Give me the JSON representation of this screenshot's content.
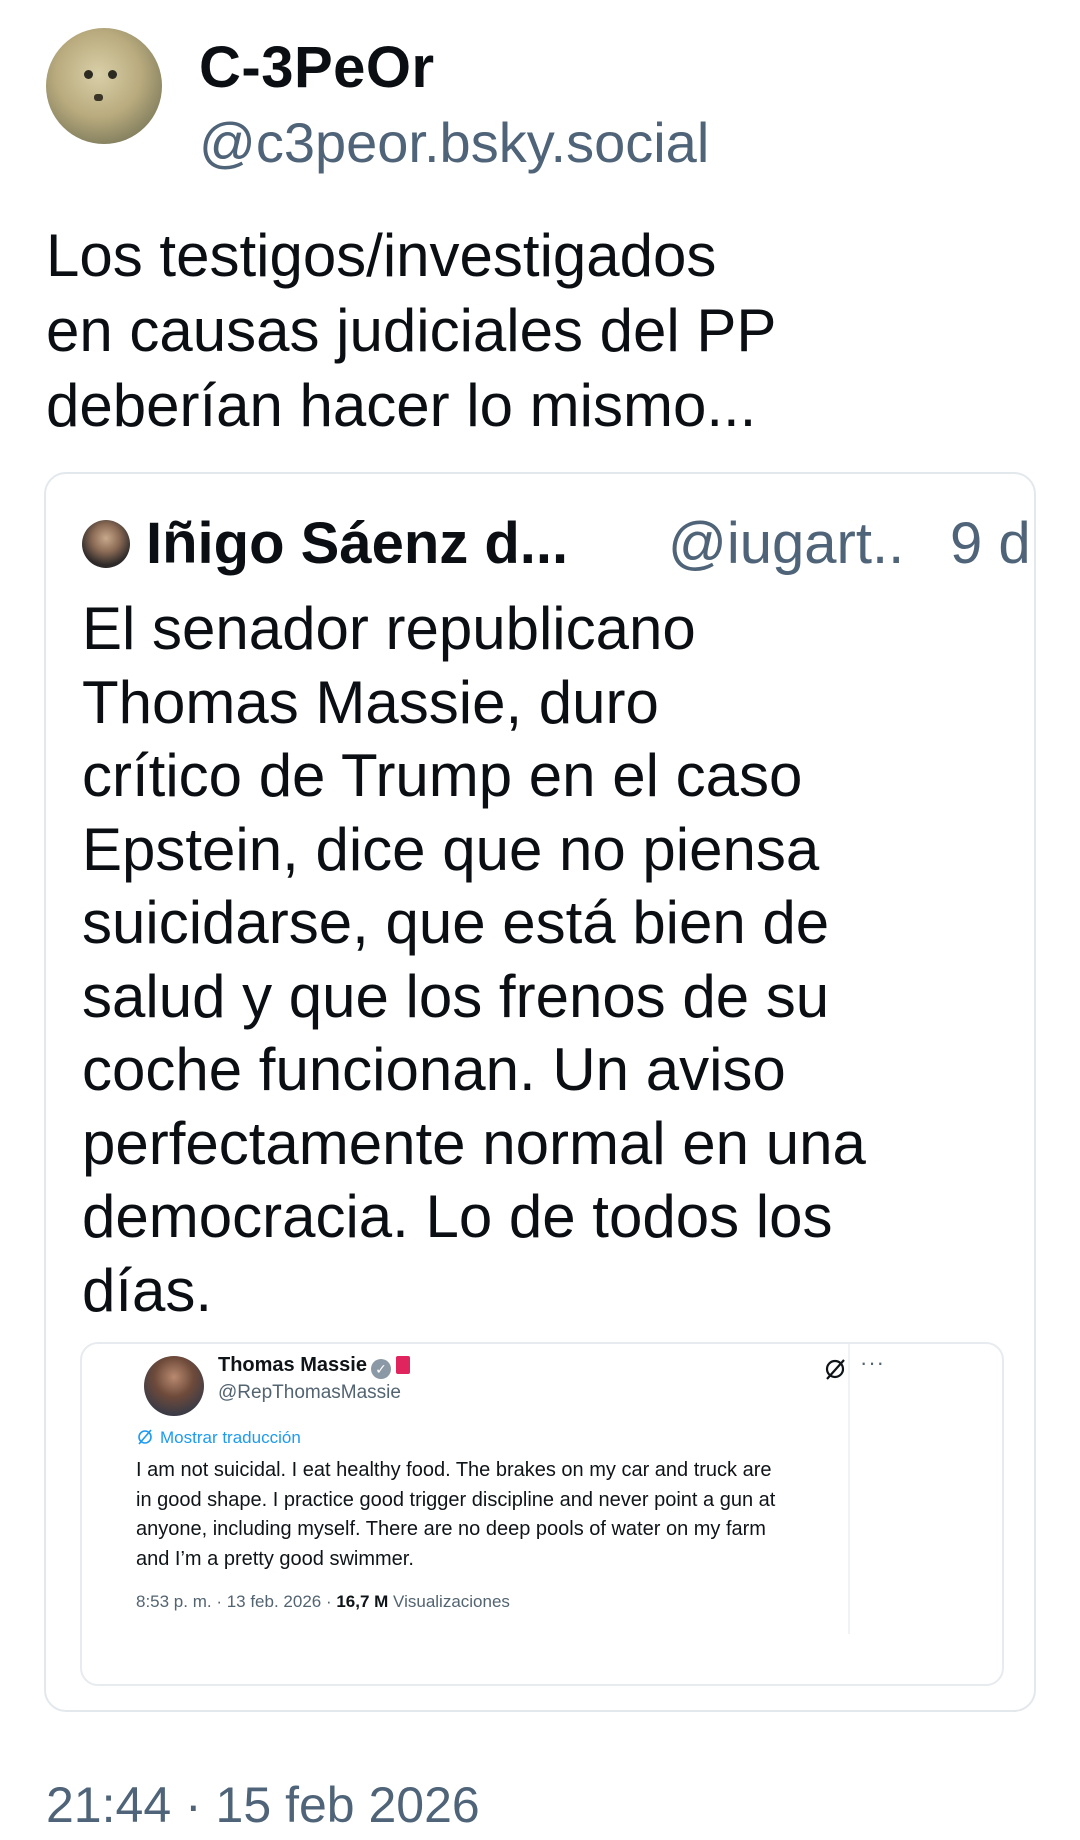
{
  "post": {
    "display_name": "C-3PeOr",
    "handle": "@c3peor.bsky.social",
    "text_lines": [
      "Los testigos/investigados",
      "en causas judiciales del PP",
      "deberían hacer lo mismo..."
    ],
    "timestamp": "21:44 · 15 feb 2026"
  },
  "quote": {
    "display_name": "Iñigo Sáenz d...",
    "handle": "@iugart..",
    "time": "9 d",
    "text_lines": [
      "El senador republicano",
      "Thomas Massie, duro",
      "crítico de Trump en el caso",
      "Epstein, dice que no piensa",
      "suicidarse, que está bien de",
      "salud y que los frenos de su",
      "coche funcionan. Un aviso",
      "perfectamente normal en una",
      "democracia. Lo de todos los",
      "días."
    ]
  },
  "embedded_tweet": {
    "display_name": "Thomas Massie",
    "handle": "@RepThomasMassie",
    "more": "···",
    "translate_label": "Mostrar traducción",
    "text_lines": [
      "I am not suicidal. I eat healthy food. The brakes on my car and truck are",
      "in good shape. I practice good trigger discipline and never point a gun at",
      "anyone,  including myself. There are no deep pools of water on my farm",
      "and I’m a pretty good swimmer."
    ],
    "time_date": "8:53 p. m. · 13 feb. 2026 · ",
    "views_count": "16,7 M",
    "views_label": " Visualizaciones"
  },
  "icons": {
    "verified": "verified-badge-icon",
    "flag": "flag-icon",
    "grok": "grok-icon",
    "translate": "translate-icon"
  }
}
